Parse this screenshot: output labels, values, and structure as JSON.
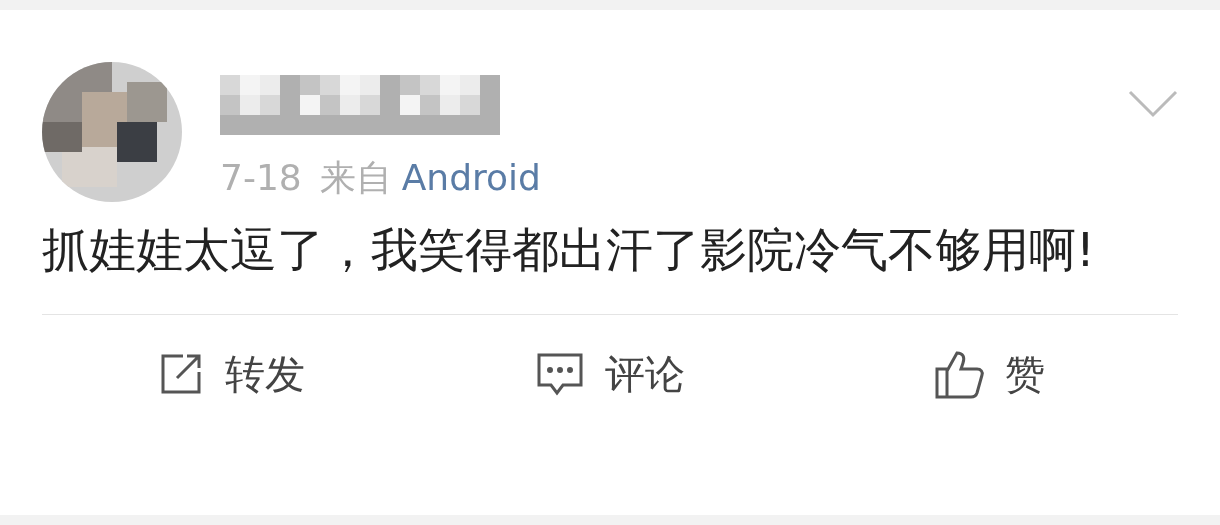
{
  "post": {
    "time": "7-18",
    "source_prefix": "来自",
    "source": "Android",
    "text": "抓娃娃太逗了，我笑得都出汗了影院冷气不够用啊!"
  },
  "actions": [
    {
      "kind": "share",
      "label": "转发"
    },
    {
      "kind": "comment",
      "label": "评论"
    },
    {
      "kind": "like",
      "label": "赞"
    }
  ]
}
